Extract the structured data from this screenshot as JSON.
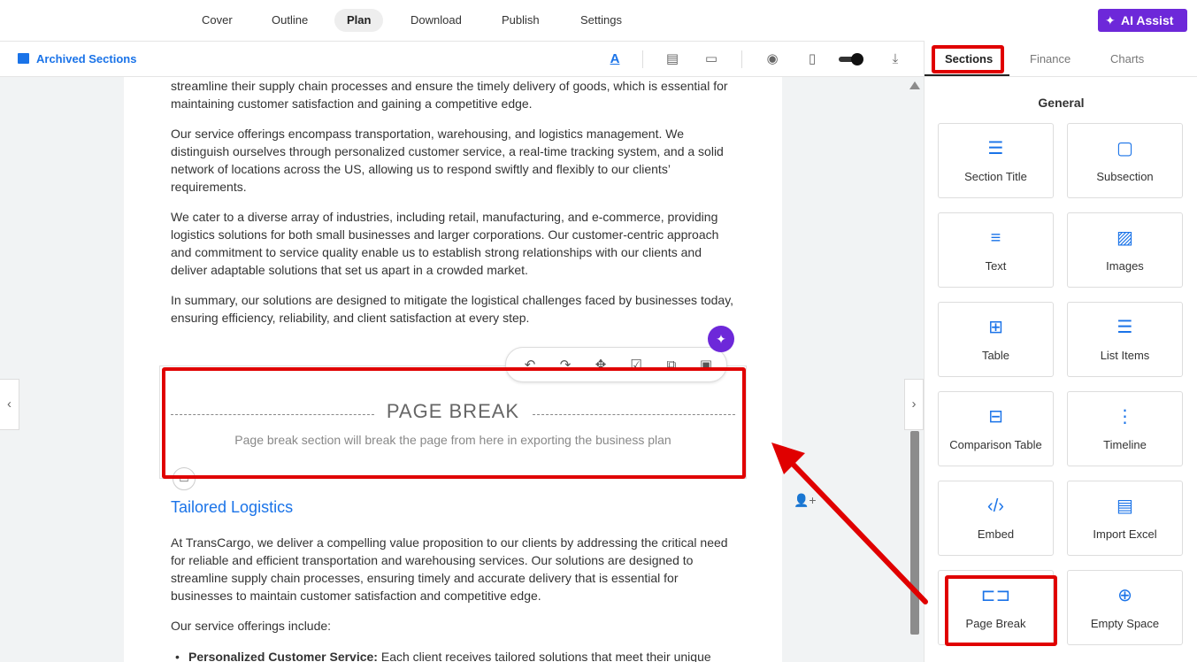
{
  "topnav": {
    "tabs": [
      {
        "label": "Cover"
      },
      {
        "label": "Outline"
      },
      {
        "label": "Plan"
      },
      {
        "label": "Download"
      },
      {
        "label": "Publish"
      },
      {
        "label": "Settings"
      }
    ],
    "active_tab": "Plan",
    "ai_assist_label": "AI Assist"
  },
  "toolbar": {
    "archived_label": "Archived Sections",
    "icons": [
      "text-color-icon",
      "copy-doc-icon",
      "comment-icon",
      "preview-eye-icon",
      "device-preview-icon",
      "toggle",
      "download-icon"
    ]
  },
  "document": {
    "paragraphs": [
      "streamline their supply chain processes and ensure the timely delivery of goods, which is essential for maintaining customer satisfaction and gaining a competitive edge.",
      "Our service offerings encompass transportation, warehousing, and logistics management. We distinguish ourselves through personalized customer service, a real-time tracking system, and a solid network of locations across the US, allowing us to respond swiftly and flexibly to our clients’ requirements.",
      "We cater to a diverse array of industries, including retail, manufacturing, and e-commerce, providing logistics solutions for both small businesses and larger corporations. Our customer-centric approach and commitment to service quality enable us to establish strong relationships with our clients and deliver adaptable solutions that set us apart in a crowded market.",
      "In summary, our solutions are designed to mitigate the logistical challenges faced by businesses today, ensuring efficiency, reliability, and client satisfaction at every step."
    ],
    "page_break": {
      "title": "PAGE BREAK",
      "description": "Page break section will break the page from here in exporting the business plan"
    },
    "heading": "Tailored Logistics",
    "after_paragraphs": [
      "At TransCargo, we deliver a compelling value proposition to our clients by addressing the critical need for reliable and efficient transportation and warehousing services. Our solutions are designed to streamline supply chain processes, ensuring timely and accurate delivery that is essential for businesses to maintain customer satisfaction and competitive edge.",
      "Our service offerings include:"
    ],
    "bullet": {
      "bold": "Personalized Customer Service:",
      "text": " Each client receives tailored solutions that meet their unique"
    }
  },
  "right_panel": {
    "tabs": [
      {
        "label": "Sections"
      },
      {
        "label": "Finance"
      },
      {
        "label": "Charts"
      }
    ],
    "active_tab": "Sections",
    "group_title": "General",
    "cards": [
      {
        "label": "Section Title",
        "icon": "section-title-icon"
      },
      {
        "label": "Subsection",
        "icon": "subsection-icon"
      },
      {
        "label": "Text",
        "icon": "text-lines-icon"
      },
      {
        "label": "Images",
        "icon": "image-icon"
      },
      {
        "label": "Table",
        "icon": "table-grid-icon"
      },
      {
        "label": "List Items",
        "icon": "list-icon"
      },
      {
        "label": "Comparison Table",
        "icon": "comparison-table-icon"
      },
      {
        "label": "Timeline",
        "icon": "timeline-icon"
      },
      {
        "label": "Embed",
        "icon": "embed-code-icon"
      },
      {
        "label": "Import Excel",
        "icon": "excel-file-icon"
      },
      {
        "label": "Page Break",
        "icon": "page-break-icon"
      },
      {
        "label": "Empty Space",
        "icon": "empty-space-icon"
      }
    ]
  },
  "colors": {
    "accent": "#1a73e8",
    "ai_purple": "#6d28d9",
    "highlight_red": "#e00000"
  }
}
